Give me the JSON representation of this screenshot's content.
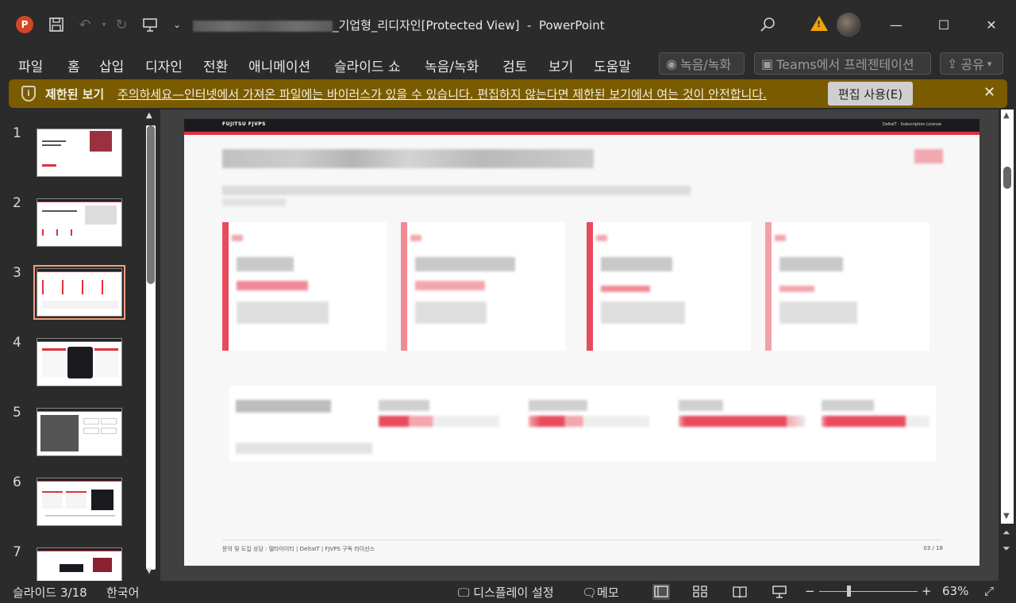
{
  "titlebar": {
    "doc_title_suffix": "_기업형_리디자인[Protected View]",
    "separator": "-",
    "app_name": "PowerPoint",
    "app_logo": "P",
    "minimize": "—",
    "restore": "☐",
    "close": "✕"
  },
  "menu": {
    "items": [
      "파일",
      "홈",
      "삽입",
      "디자인",
      "전환",
      "애니메이션",
      "슬라이드 쇼",
      "녹음/녹화",
      "검토",
      "보기",
      "도움말"
    ],
    "record_button": "녹음/녹화",
    "teams_button": "Teams에서 프레젠테이션",
    "share_button": "공유"
  },
  "message_bar": {
    "title": "제한된 보기",
    "text": "주의하세요—인터넷에서 가져온 파일에는 바이러스가 있을 수 있습니다. 편집하지 않는다면 제한된 보기에서 여는 것이 안전합니다.",
    "edit_button": "편집 사용(E)",
    "close": "✕"
  },
  "thumbnails": {
    "numbers": [
      "1",
      "2",
      "3",
      "4",
      "5",
      "6",
      "7"
    ],
    "selected_index": 3
  },
  "slide": {
    "brand": "FUJITSU FJVPS",
    "header_right": "DeltaIT · Subscription License",
    "footer": "문의 및 도입 상담 : 델타아이티  |  DeltaIT  |  FJVPS 구독 라이선스",
    "page": "03 / 18"
  },
  "status": {
    "slide_info": "슬라이드 3/18",
    "language": "한국어",
    "display_settings": "디스플레이 설정",
    "notes": "메모",
    "zoom_minus": "−",
    "zoom_plus": "+",
    "zoom_level": "63%"
  },
  "colors": {
    "accent": "#e03040",
    "message_bar": "#7a5b00"
  }
}
